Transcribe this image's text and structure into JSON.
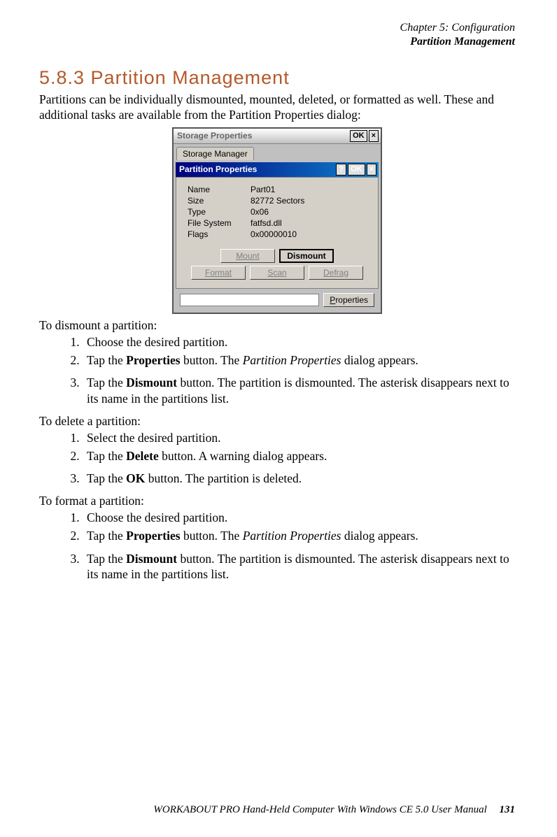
{
  "runningHead": {
    "line1": "Chapter  5:  Configuration",
    "line2": "Partition Management"
  },
  "heading": "5.8.3   Partition  Management",
  "intro": "Partitions can be individually dismounted, mounted, deleted, or formatted as well. These and additional tasks are available from the Partition Properties dialog:",
  "screenshot": {
    "outerTitle": "Storage Properties",
    "ok": "OK",
    "close": "×",
    "tab": "Storage Manager",
    "innerTitle": "Partition Properties",
    "help": "?",
    "fields": {
      "nameLabel": "Name",
      "nameVal": "Part01",
      "sizeLabel": "Size",
      "sizeVal": "82772 Sectors",
      "typeLabel": "Type",
      "typeVal": "0x06",
      "fsLabel": "File System",
      "fsVal": "fatfsd.dll",
      "flagsLabel": "Flags",
      "flagsVal": "0x00000010"
    },
    "buttons": {
      "mount": "Mount",
      "dismount": "Dismount",
      "format": "Format",
      "scan": "Scan",
      "defrag": "Defrag",
      "properties": "Properties"
    }
  },
  "dismount": {
    "lead": "To dismount a partition:",
    "s1": "Choose the desired partition.",
    "s2a": "Tap the ",
    "s2b": "Properties",
    "s2c": " button. The ",
    "s2d": "Partition Properties",
    "s2e": " dialog appears.",
    "s3a": "Tap the ",
    "s3b": "Dismount",
    "s3c": " button. The partition is dismounted. The asterisk disappears next to its name in the partitions list."
  },
  "delete": {
    "lead": "To delete a partition:",
    "s1": "Select the desired partition.",
    "s2a": "Tap the ",
    "s2b": "Delete",
    "s2c": " button. A warning dialog appears.",
    "s3a": "Tap the ",
    "s3b": "OK",
    "s3c": " button. The partition is deleted."
  },
  "format": {
    "lead": "To format a partition:",
    "s1": "Choose the desired partition.",
    "s2a": "Tap the ",
    "s2b": "Properties",
    "s2c": " button. The ",
    "s2d": "Partition Properties",
    "s2e": " dialog appears.",
    "s3a": "Tap the ",
    "s3b": "Dismount",
    "s3c": " button. The partition is dismounted. The asterisk disappears next to its name in the partitions list."
  },
  "footer": {
    "text": "WORKABOUT PRO Hand-Held Computer With Windows CE 5.0 User Manual",
    "page": "131"
  }
}
